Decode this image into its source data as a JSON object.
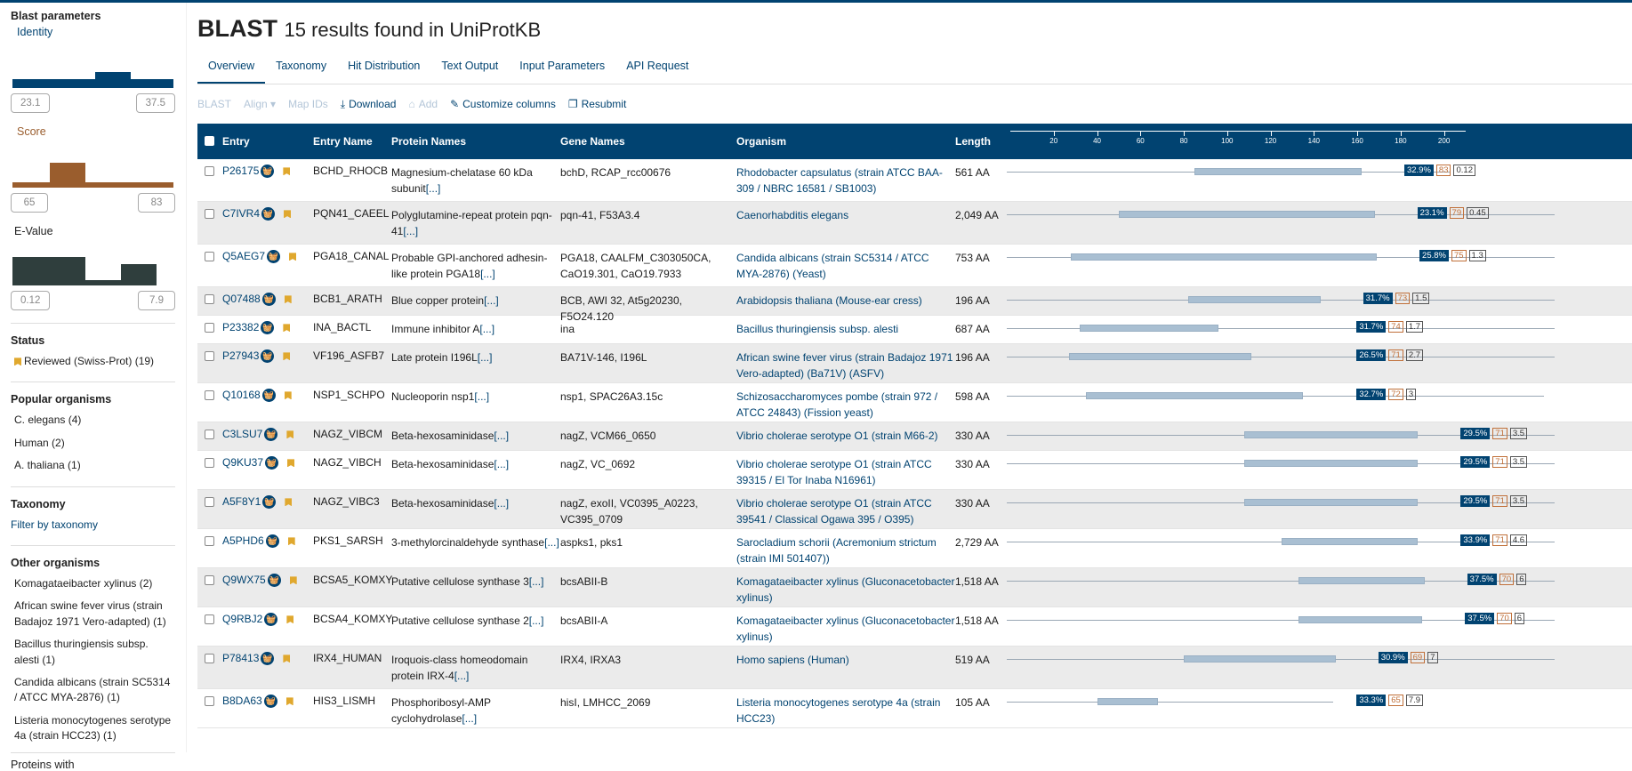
{
  "page": {
    "title": "BLAST",
    "subtitle": "15 results found in UniProtKB"
  },
  "tabs": [
    "Overview",
    "Taxonomy",
    "Hit Distribution",
    "Text Output",
    "Input Parameters",
    "API Request"
  ],
  "toolbar": {
    "blast": "BLAST",
    "align": "Align",
    "mapids": "Map IDs",
    "download": "Download",
    "add": "Add",
    "customize": "Customize columns",
    "resubmit": "Resubmit"
  },
  "sidebar": {
    "heading": "Blast parameters",
    "identity": {
      "label": "Identity",
      "min": "23.1",
      "max": "37.5",
      "color": "#014371"
    },
    "score": {
      "label": "Score",
      "min": "65",
      "max": "83",
      "color": "#9a5d2d"
    },
    "evalue": {
      "label": "E-Value",
      "min": "0.12",
      "max": "7.9",
      "color": "#2f3e3d"
    },
    "status": {
      "title": "Status",
      "items": [
        {
          "label": "Reviewed (Swiss-Prot) (19)"
        }
      ]
    },
    "popular": {
      "title": "Popular organisms",
      "items": [
        "C. elegans (4)",
        "Human (2)",
        "A. thaliana (1)"
      ]
    },
    "taxonomy": {
      "title": "Taxonomy",
      "link": "Filter by taxonomy"
    },
    "other": {
      "title": "Other organisms",
      "items": [
        "Komagataeibacter xylinus (2)",
        "African swine fever virus (strain Badajoz 1971 Vero-adapted) (1)",
        "Bacillus thuringiensis subsp. alesti (1)",
        "Candida albicans (strain SC5314 / ATCC MYA-2876) (1)",
        "Listeria monocytogenes serotype 4a (strain HCC23) (1)"
      ]
    },
    "proteins_with": "Proteins with"
  },
  "table": {
    "headers": {
      "entry": "Entry",
      "entry_name": "Entry Name",
      "protein": "Protein Names",
      "gene": "Gene Names",
      "organism": "Organism",
      "length": "Length"
    },
    "axis_ticks": [
      "20",
      "40",
      "60",
      "80",
      "100",
      "120",
      "140",
      "160",
      "180",
      "200"
    ],
    "more": "[...]",
    "rows": [
      {
        "acc": "P26175",
        "name": "BCHD_RHOCB",
        "protein": "Magnesium-chelatase 60 kDa subunit",
        "gene_main": "bchD",
        "gene_rest": ", RCAP_rcc00676",
        "org": "Rhodobacter capsulatus (strain ATCC BAA-309 / NBRC 16581 / SB1003)",
        "len": "561 AA",
        "id": "32.9%",
        "score": "83",
        "ev": "0.12",
        "q": [
          85,
          162
        ],
        "ql": 162
      },
      {
        "acc": "C7IVR4",
        "name": "PQN41_CAEEL",
        "protein": "Polyglutamine-repeat protein pqn-41",
        "gene_main": "pqn-41",
        "gene_rest": ", F53A3.4",
        "org": "Caenorhabditis elegans",
        "len": "2,049 AA",
        "id": "23.1%",
        "score": "79",
        "ev": "0.45",
        "q": [
          50,
          168
        ],
        "ql": 210
      },
      {
        "acc": "Q5AEG7",
        "name": "PGA18_CANAL",
        "protein": "Probable GPI-anchored adhesin-like protein PGA18",
        "gene_main": "PGA18",
        "gene_rest": ", CAALFM_C303050CA, CaO19.301, CaO19.7933",
        "org": "Candida albicans (strain SC5314 / ATCC MYA-2876) (Yeast)",
        "len": "753 AA",
        "id": "25.8%",
        "score": "75",
        "ev": "1.3",
        "q": [
          28,
          169
        ],
        "ql": 210
      },
      {
        "acc": "Q07488",
        "name": "BCB1_ARATH",
        "protein": "Blue copper protein",
        "gene_main": "BCB",
        "gene_rest": ", AWI 32, At5g20230, F5O24.120",
        "org": "Arabidopsis thaliana (Mouse-ear cress)",
        "len": "196 AA",
        "id": "31.7%",
        "score": "73",
        "ev": "1.5",
        "q": [
          82,
          143
        ],
        "ql": 210
      },
      {
        "acc": "P23382",
        "name": "INA_BACTL",
        "protein": "Immune inhibitor A",
        "gene_main": "ina",
        "gene_rest": "",
        "org": "Bacillus thuringiensis subsp. alesti",
        "len": "687 AA",
        "id": "31.7%",
        "score": "74",
        "ev": "1.7",
        "q": [
          32,
          96
        ],
        "ql": 210
      },
      {
        "acc": "P27943",
        "name": "VF196_ASFB7",
        "protein": "Late protein I196L",
        "gene_main": "BA71V-146",
        "gene_rest": ", I196L",
        "org": "African swine fever virus (strain Badajoz 1971 Vero-adapted) (Ba71V) (ASFV)",
        "len": "196 AA",
        "id": "26.5%",
        "score": "71",
        "ev": "2.7",
        "q": [
          27,
          111
        ],
        "ql": 210
      },
      {
        "acc": "Q10168",
        "name": "NSP1_SCHPO",
        "protein": "Nucleoporin nsp1",
        "gene_main": "nsp1",
        "gene_rest": ", SPAC26A3.15c",
        "org": "Schizosaccharomyces pombe (strain 972 / ATCC 24843) (Fission yeast)",
        "len": "598 AA",
        "id": "32.7%",
        "score": "72",
        "ev": "3",
        "q": [
          35,
          135
        ],
        "ql": 205
      },
      {
        "acc": "C3LSU7",
        "name": "NAGZ_VIBCM",
        "protein": "Beta-hexosaminidase",
        "gene_main": "nagZ",
        "gene_rest": ", VCM66_0650",
        "org": "Vibrio cholerae serotype O1 (strain M66-2)",
        "len": "330 AA",
        "id": "29.5%",
        "score": "71",
        "ev": "3.5",
        "q": [
          108,
          188
        ],
        "ql": 210
      },
      {
        "acc": "Q9KU37",
        "name": "NAGZ_VIBCH",
        "protein": "Beta-hexosaminidase",
        "gene_main": "nagZ",
        "gene_rest": ", VC_0692",
        "org": "Vibrio cholerae serotype O1 (strain ATCC 39315 / El Tor Inaba N16961)",
        "len": "330 AA",
        "id": "29.5%",
        "score": "71",
        "ev": "3.5",
        "q": [
          108,
          188
        ],
        "ql": 210
      },
      {
        "acc": "A5F8Y1",
        "name": "NAGZ_VIBC3",
        "protein": "Beta-hexosaminidase",
        "gene_main": "nagZ",
        "gene_rest": ", exoII, VC0395_A0223, VC395_0709",
        "org": "Vibrio cholerae serotype O1 (strain ATCC 39541 / Classical Ogawa 395 / O395)",
        "len": "330 AA",
        "id": "29.5%",
        "score": "71",
        "ev": "3.5",
        "q": [
          108,
          188
        ],
        "ql": 210
      },
      {
        "acc": "A5PHD6",
        "name": "PKS1_SARSH",
        "protein": "3-methylorcinaldehyde synthase",
        "gene_main": "aspks1",
        "gene_rest": ", pks1",
        "org": "Sarocladium schorii (Acremonium strictum (strain IMI 501407))",
        "len": "2,729 AA",
        "id": "33.9%",
        "score": "71",
        "ev": "4.6",
        "q": [
          125,
          188
        ],
        "ql": 210
      },
      {
        "acc": "Q9WX75",
        "name": "BCSA5_KOMXY",
        "protein": "Putative cellulose synthase 3",
        "gene_main": "bcsABII-B",
        "gene_rest": "",
        "org": "Komagataeibacter xylinus (Gluconacetobacter xylinus)",
        "len": "1,518 AA",
        "id": "37.5%",
        "score": "70",
        "ev": "6",
        "q": [
          133,
          191
        ],
        "ql": 210
      },
      {
        "acc": "Q9RBJ2",
        "name": "BCSA4_KOMXY",
        "protein": "Putative cellulose synthase 2",
        "gene_main": "bcsABII-A",
        "gene_rest": "",
        "org": "Komagataeibacter xylinus (Gluconacetobacter xylinus)",
        "len": "1,518 AA",
        "id": "37.5%",
        "score": "70",
        "ev": "6",
        "q": [
          133,
          190
        ],
        "ql": 210
      },
      {
        "acc": "P78413",
        "name": "IRX4_HUMAN",
        "protein": "Iroquois-class homeodomain protein IRX-4",
        "gene_main": "IRX4",
        "gene_rest": ", IRXA3",
        "org": "Homo sapiens (Human)",
        "len": "519 AA",
        "id": "30.9%",
        "score": "69",
        "ev": "7",
        "q": [
          80,
          150
        ],
        "ql": 210
      },
      {
        "acc": "B8DA63",
        "name": "HIS3_LISMH",
        "protein": "Phosphoribosyl-AMP cyclohydrolase",
        "gene_main": "hisI",
        "gene_rest": ", LMHCC_2069",
        "org": "Listeria monocytogenes serotype 4a (strain HCC23)",
        "len": "105 AA",
        "id": "33.3%",
        "score": "65",
        "ev": "7.9",
        "q": [
          40,
          68
        ],
        "ql": 108
      }
    ]
  }
}
